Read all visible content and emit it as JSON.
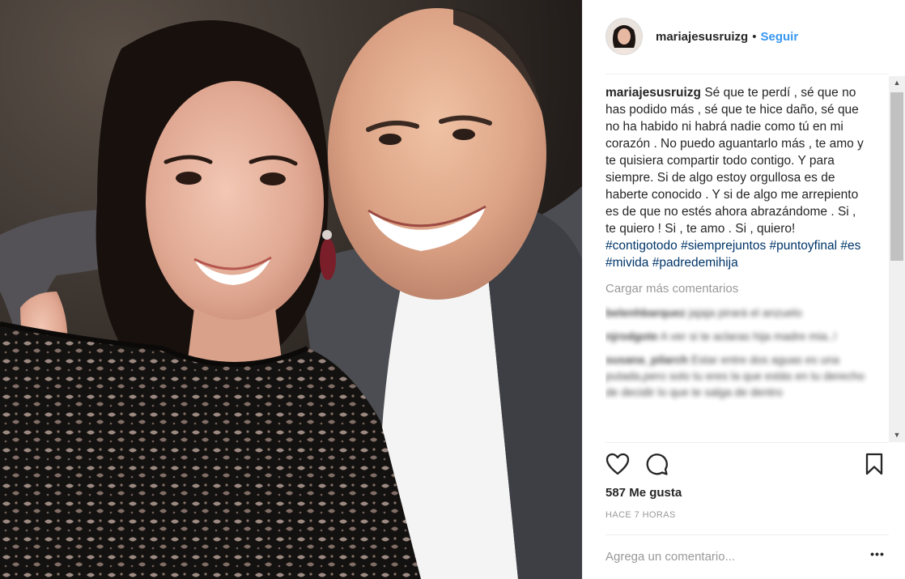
{
  "post": {
    "username": "mariajesusruizg",
    "separator": "•",
    "follow_label": "Seguir",
    "caption_user": "mariajesusruizg",
    "caption_text": "Sé que te perdí , sé que no has podido más , sé que te hice daño, sé que no ha habido ni habrá nadie como tú en mi corazón . No puedo aguantarlo más , te amo y te quisiera compartir todo contigo. Y para siempre. Si de algo estoy orgullosa es de haberte conocido . Y si de algo me arrepiento es de que no estés ahora abrazándome . Si , te quiero ! Si , te amo . Si , quiero!",
    "hashtags": [
      "#contigotodo",
      "#siemprejuntos",
      "#puntoyfinal",
      "#es",
      "#mivida",
      "#padredemihija"
    ],
    "load_more": "Cargar más comentarios",
    "blurred_comments": [
      {
        "user": "belenhbarquez",
        "text": "jajaja pirará el anzuelo"
      },
      {
        "user": "njrodgote",
        "text": "A ver si te aclaras hija madre mia..!"
      },
      {
        "user": "susana_pilarch",
        "text": "Estar entre dos aguas es una putada,pero solo tu eres la que estás en tu derecho de decidir lo que te salga de dentro"
      }
    ],
    "likes": "587 Me gusta",
    "time": "HACE 7 HORAS",
    "comment_placeholder": "Agrega un comentario...",
    "more_label": "•••"
  },
  "icons": {
    "like": "heart-outline-icon",
    "comment": "speech-bubble-icon",
    "save": "bookmark-icon",
    "more": "ellipsis-icon"
  },
  "colors": {
    "link_blue": "#3897f0",
    "hashtag_blue": "#003569",
    "muted": "#999999",
    "text": "#262626"
  }
}
